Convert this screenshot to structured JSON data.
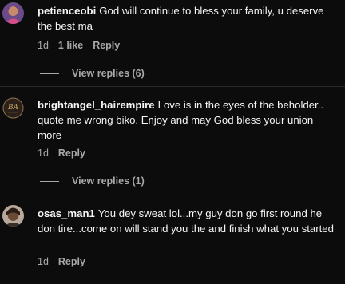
{
  "comments": [
    {
      "username": "petienceobi",
      "text": "God will continue to bless your family, u deserve the best ma",
      "time": "1d",
      "likes": "1 like",
      "reply_label": "Reply",
      "view_replies": "View replies (6)"
    },
    {
      "username": "brightangel_hairempire",
      "text": "Love is in the eyes of the beholder.. quote me wrong biko. Enjoy and may God bless your union more",
      "time": "1d",
      "reply_label": "Reply",
      "view_replies": "View replies (1)"
    },
    {
      "username": "osas_man1",
      "text": "You dey sweat lol...my guy don go first round he don tire...come on will stand you the and finish what you started",
      "time": "1d",
      "reply_label": "Reply"
    }
  ],
  "colors": {
    "background": "#0c0c0c",
    "text": "#f5f5f5",
    "muted": "#a8a8a8"
  },
  "avatars": [
    "profile-photo-icon",
    "brand-logo-icon",
    "profile-photo-icon"
  ]
}
